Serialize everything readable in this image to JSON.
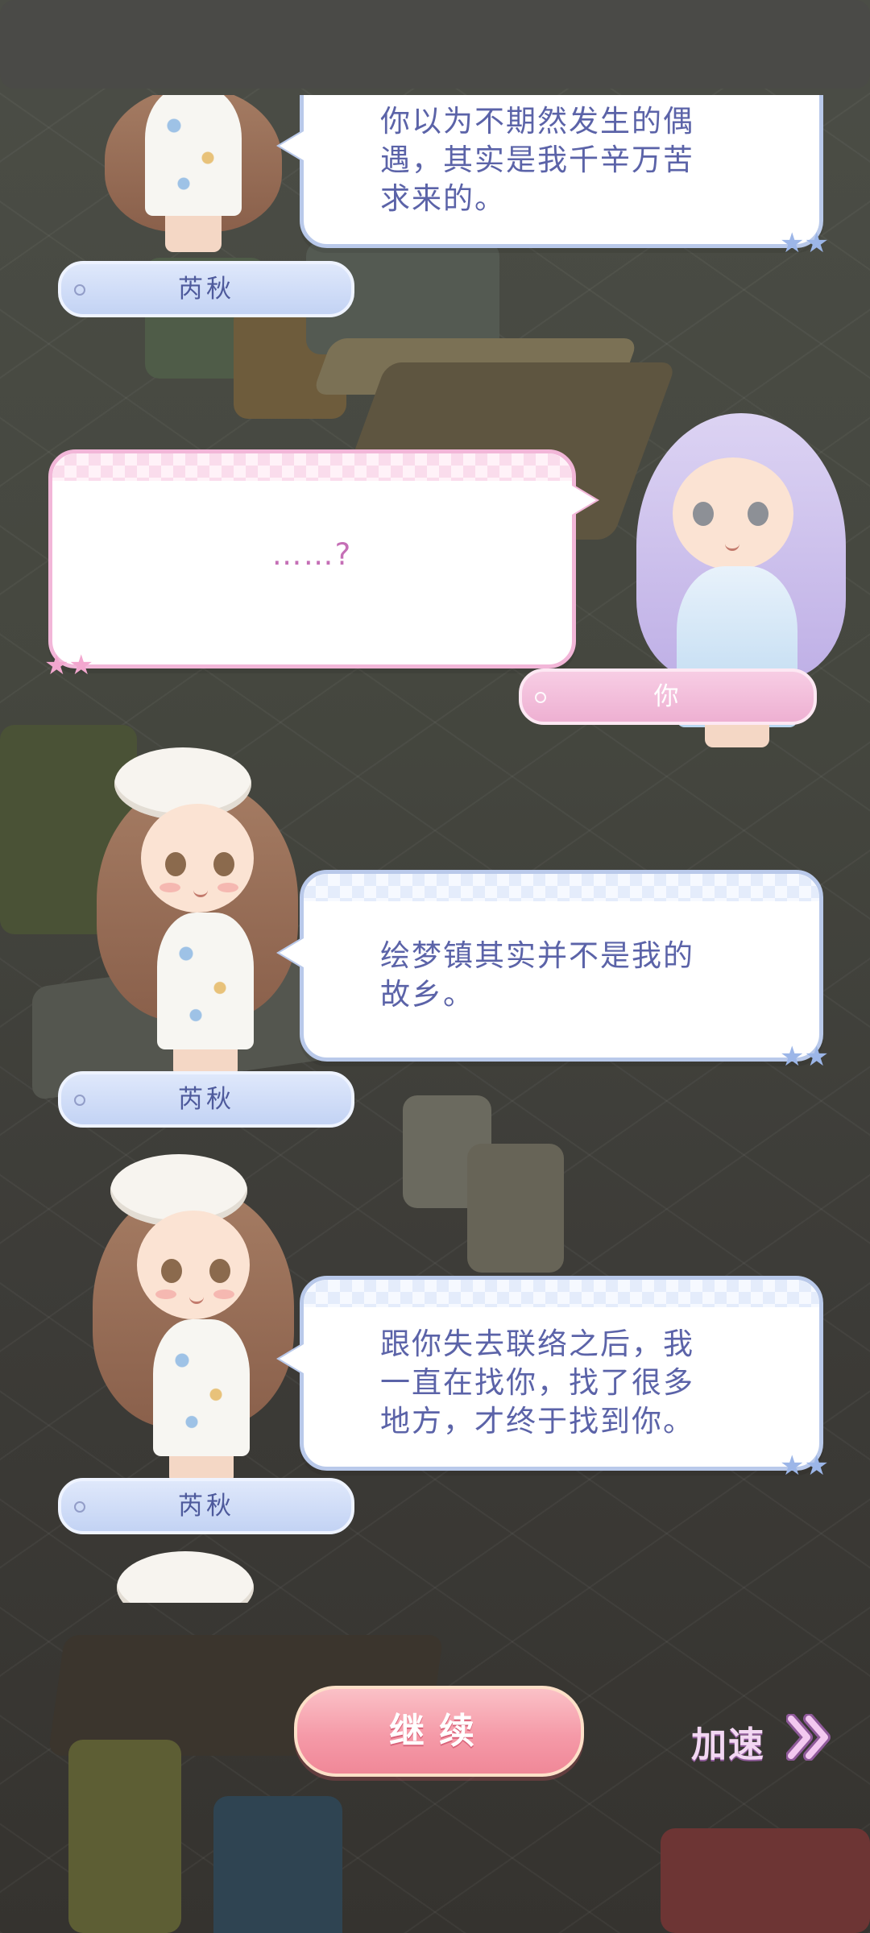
{
  "dialogue": [
    {
      "speaker": "芮秋",
      "text_lines": [
        "你以为不期然发生的偶",
        "遇，其实是我千辛万苦",
        "求来的。"
      ]
    },
    {
      "speaker": "你",
      "text_lines": [
        "……?"
      ]
    },
    {
      "speaker": "芮秋",
      "text_lines": [
        "绘梦镇其实并不是我的",
        "故乡。"
      ]
    },
    {
      "speaker": "芮秋",
      "text_lines": [
        "跟你失去联络之后，我",
        "一直在找你，找了很多",
        "地方，才终于找到你。"
      ]
    }
  ],
  "controls": {
    "continue_label": "继续",
    "speed_label": "加速"
  },
  "colors": {
    "npc_bubble_border": "#b9c9ea",
    "player_bubble_border": "#f2b6d8",
    "npc_text": "#5b63a8",
    "player_text": "#c56fb6",
    "continue_button": "#f59aa8"
  },
  "icons": {
    "speed": "double-chevron-right-icon",
    "bubble_decoration": "stars-icon"
  }
}
